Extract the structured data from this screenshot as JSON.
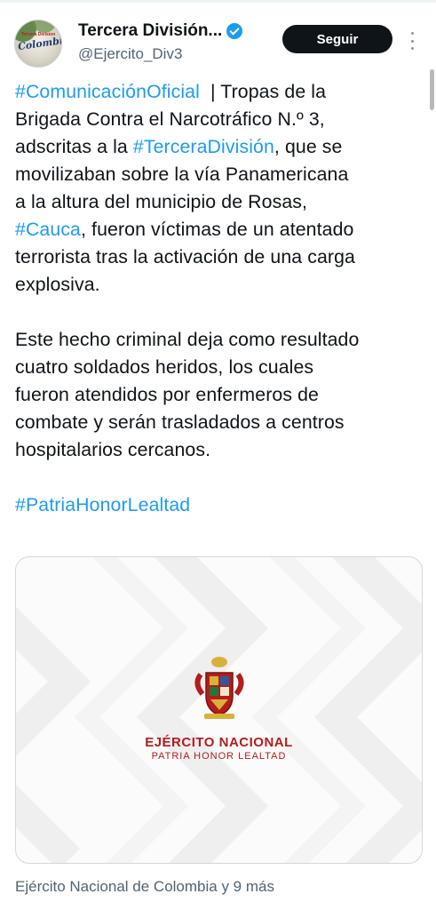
{
  "header": {
    "display_name": "Tercera División...",
    "handle": "@Ejercito_Div3",
    "follow_label": "Seguir",
    "verified_icon": "verified-badge-icon",
    "more_icon": "more-options-icon",
    "avatar_text_small": "Tercera Division",
    "avatar_text_script": "Colombia"
  },
  "tweet": {
    "lines": [
      [
        {
          "t": "#ComunicaciónOficial",
          "h": true
        },
        {
          "t": "  | Tropas de la",
          "h": false
        }
      ],
      [
        {
          "t": "Brigada Contra el Narcotráfico N.º 3,",
          "h": false
        }
      ],
      [
        {
          "t": "adscritas a la ",
          "h": false
        },
        {
          "t": "#TerceraDivisión",
          "h": true
        },
        {
          "t": ", que se",
          "h": false
        }
      ],
      [
        {
          "t": "movilizaban sobre la vía Panamericana",
          "h": false
        }
      ],
      [
        {
          "t": "a la altura del municipio de Rosas,",
          "h": false
        }
      ],
      [
        {
          "t": "#Cauca",
          "h": true
        },
        {
          "t": ", fueron víctimas de un atentado",
          "h": false
        }
      ],
      [
        {
          "t": "terrorista tras la activación de una carga",
          "h": false
        }
      ],
      [
        {
          "t": "explosiva.",
          "h": false
        }
      ],
      [],
      [
        {
          "t": "Este hecho criminal deja como resultado",
          "h": false
        }
      ],
      [
        {
          "t": "cuatro soldados heridos, los cuales",
          "h": false
        }
      ],
      [
        {
          "t": "fueron atendidos por enfermeros de",
          "h": false
        }
      ],
      [
        {
          "t": "combate y serán trasladados a centros",
          "h": false
        }
      ],
      [
        {
          "t": "hospitalarios cercanos.",
          "h": false
        }
      ],
      [],
      [
        {
          "t": "#PatriaHonorLealtad",
          "h": true
        }
      ]
    ]
  },
  "media": {
    "logo_title": "EJÉRCITO NACIONAL",
    "logo_motto": "PATRIA HONOR LEALTAD",
    "emblem_icon": "army-coat-of-arms-icon"
  },
  "card": {
    "source_text": "Ejército Nacional de Colombia y 9 más"
  },
  "colors": {
    "link": "#1d9bf0",
    "text": "#0f1419",
    "secondary": "#536471",
    "button_bg": "#0f1419",
    "brand_red": "#b51c1c"
  }
}
